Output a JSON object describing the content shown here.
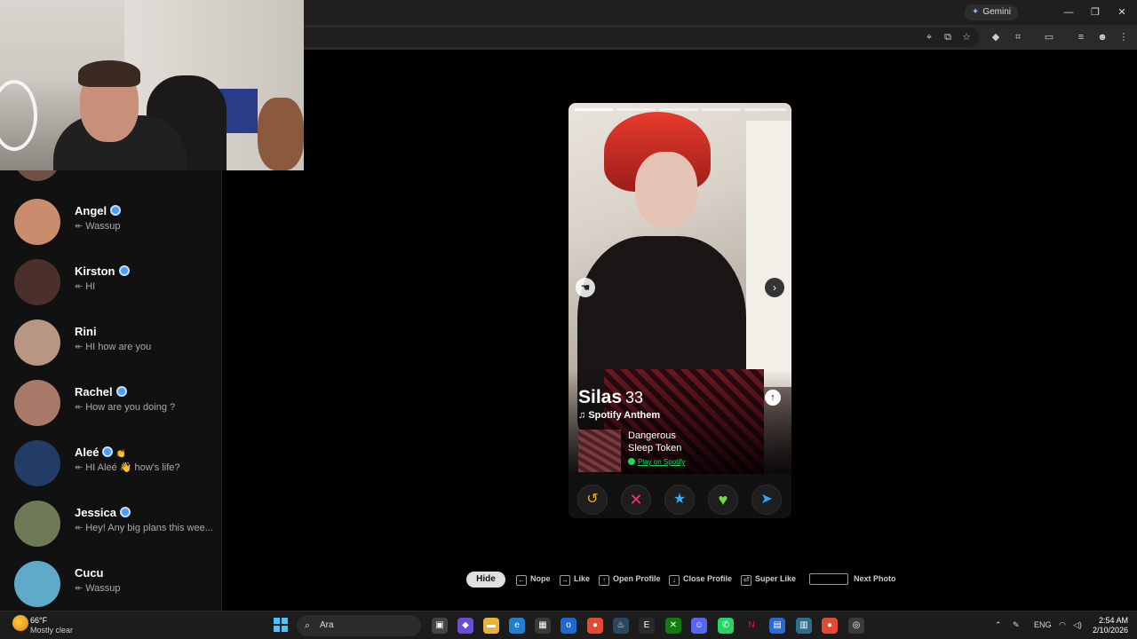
{
  "browser": {
    "gemini_label": "Gemini",
    "window_controls": {
      "minimize": "—",
      "restore": "❐",
      "close": "✕"
    },
    "toolbar_icons": [
      "location-icon",
      "install-icon",
      "bookmark-star-icon",
      "extension-puzzle-icon",
      "extensions-icon",
      "cast-icon",
      "tab-search-icon",
      "profile-icon",
      "menu-icon"
    ]
  },
  "sidebar": {
    "matches": [
      {
        "name": "Angel",
        "verified": true,
        "preview": "Wassup",
        "avatar_color": "#c98d6e"
      },
      {
        "name": "Kirston",
        "verified": true,
        "preview": "HI",
        "avatar_color": "#4a2f2a"
      },
      {
        "name": "Rini",
        "verified": false,
        "preview": "HI how are you",
        "avatar_color": "#b89684"
      },
      {
        "name": "Rachel",
        "verified": true,
        "preview": "How are you doing ?",
        "avatar_color": "#a77968"
      },
      {
        "name": "Aleé",
        "verified": true,
        "extra": "👏",
        "preview": "HI Aleé 👋 how's life?",
        "avatar_color": "#233c66"
      },
      {
        "name": "Jessica",
        "verified": true,
        "preview": "Hey! Any big plans this wee...",
        "avatar_color": "#6e7a56"
      },
      {
        "name": "Cucu",
        "verified": false,
        "preview": "Wassup",
        "avatar_color": "#5fa9c9"
      }
    ]
  },
  "profile": {
    "name": "Silas",
    "age": "33",
    "anthem_label": "Spotify Anthem",
    "song_title": "Dangerous",
    "song_artist": "Sleep Token",
    "spotify_link": "Play on Spotify",
    "photo_count": 5,
    "active_photo": 1,
    "prev_icon": "hand-cursor-icon",
    "next_icon": "chevron-right-icon",
    "info_icon": "arrow-up-icon",
    "actions": [
      {
        "name": "rewind",
        "glyph": "↺",
        "color": "#f0a81e"
      },
      {
        "name": "nope",
        "glyph": "✕",
        "color": "#ff2d72"
      },
      {
        "name": "super-like",
        "glyph": "★",
        "color": "#3aa8ff"
      },
      {
        "name": "like",
        "glyph": "♥",
        "color": "#6fe03a"
      },
      {
        "name": "boost",
        "glyph": "➤",
        "color": "#2fa5ff"
      }
    ]
  },
  "hints": {
    "hide_label": "Hide",
    "items": [
      {
        "key": "←",
        "label": "Nope"
      },
      {
        "key": "→",
        "label": "Like"
      },
      {
        "key": "↑",
        "label": "Open Profile"
      },
      {
        "key": "↓",
        "label": "Close Profile"
      },
      {
        "key": "⏎",
        "label": "Super Like"
      },
      {
        "key": "",
        "label": "Next Photo"
      }
    ]
  },
  "taskbar": {
    "weather_temp": "66°F",
    "weather_desc": "Mostly clear",
    "search_placeholder": "Ara",
    "language": "ENG",
    "time": "2:54 AM",
    "date": "2/10/2026"
  }
}
